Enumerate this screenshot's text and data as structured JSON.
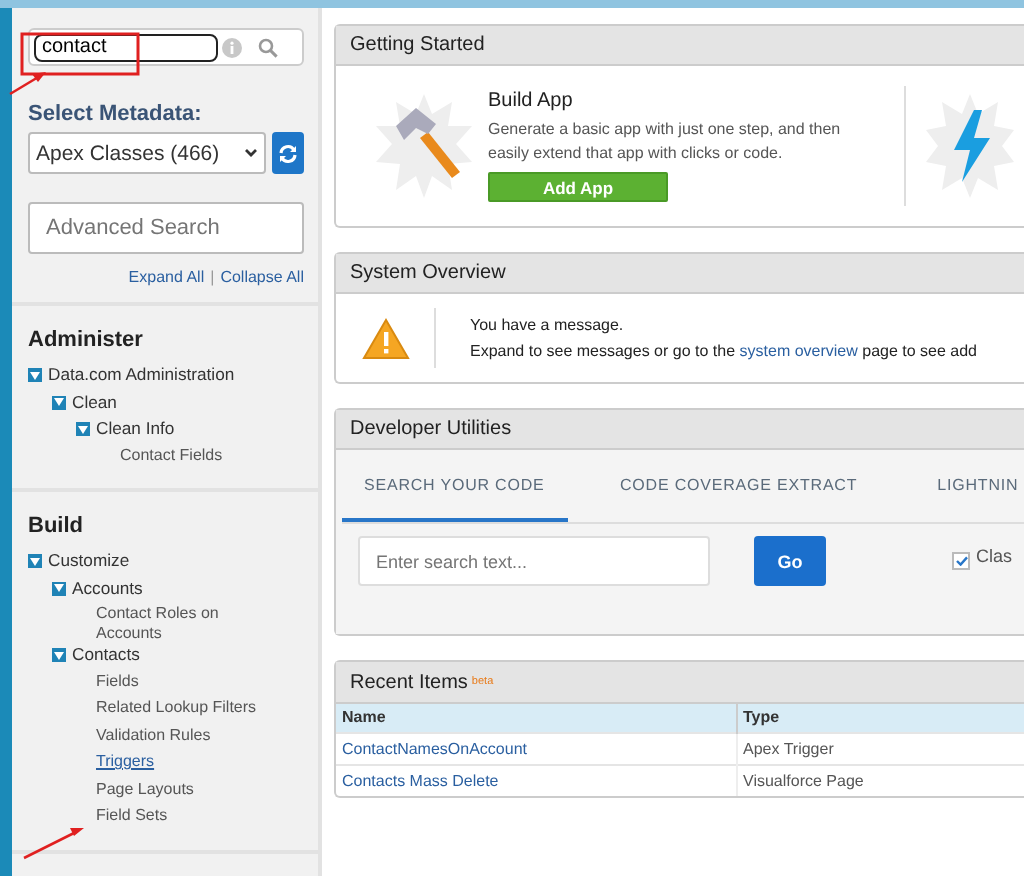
{
  "sidebar": {
    "search": {
      "value": "contact"
    },
    "metadata_label": "Select Metadata:",
    "metadata_select": {
      "value": "Apex Classes (466)"
    },
    "advanced_search": {
      "placeholder": "Advanced Search"
    },
    "expand_all": "Expand All",
    "separator": "|",
    "collapse_all": "Collapse All",
    "sections": [
      {
        "title": "Administer",
        "items": [
          {
            "label": "Data.com Administration",
            "kind": "folder",
            "expanded": true,
            "children": [
              {
                "label": "Clean",
                "kind": "folder",
                "expanded": true,
                "children": [
                  {
                    "label": "Clean Info",
                    "kind": "folder",
                    "expanded": true,
                    "children": [
                      {
                        "label": "Contact Fields",
                        "kind": "leaf"
                      }
                    ]
                  }
                ]
              }
            ]
          }
        ]
      },
      {
        "title": "Build",
        "items": [
          {
            "label": "Customize",
            "kind": "folder",
            "expanded": true,
            "children": [
              {
                "label": "Accounts",
                "kind": "folder",
                "expanded": true,
                "children": [
                  {
                    "label": "Contact Roles on Accounts",
                    "kind": "leaf"
                  }
                ]
              },
              {
                "label": "Contacts",
                "kind": "folder",
                "expanded": true,
                "children": [
                  {
                    "label": "Fields",
                    "kind": "leaf"
                  },
                  {
                    "label": "Related Lookup Filters",
                    "kind": "leaf"
                  },
                  {
                    "label": "Validation Rules",
                    "kind": "leaf"
                  },
                  {
                    "label": "Triggers",
                    "kind": "link"
                  },
                  {
                    "label": "Page Layouts",
                    "kind": "leaf"
                  },
                  {
                    "label": "Field Sets",
                    "kind": "leaf"
                  }
                ]
              }
            ]
          }
        ]
      }
    ]
  },
  "getting_started": {
    "title": "Getting Started",
    "heading": "Build App",
    "text": "Generate a basic app with just one step, and then easily extend that app with clicks or code.",
    "button": "Add App"
  },
  "system_overview": {
    "title": "System Overview",
    "message": "You have a message.",
    "detail_before": "Expand to see messages or go to the",
    "link": "system overview",
    "detail_after": "page to see add"
  },
  "developer_utilities": {
    "title": "Developer Utilities",
    "tabs": [
      {
        "label": "SEARCH YOUR CODE",
        "selected": true
      },
      {
        "label": "CODE COVERAGE EXTRACT",
        "selected": false
      },
      {
        "label": "LIGHTNIN",
        "selected": false
      }
    ],
    "search": {
      "placeholder": "Enter search text..."
    },
    "go": "Go",
    "option": {
      "label": "Clas",
      "checked": true
    }
  },
  "recent_items": {
    "title": "Recent Items",
    "badge": "beta",
    "columns": [
      "Name",
      "Type"
    ],
    "rows": [
      [
        "ContactNamesOnAccount",
        "Apex Trigger"
      ],
      [
        "Contacts Mass Delete",
        "Visualforce Page"
      ]
    ]
  }
}
